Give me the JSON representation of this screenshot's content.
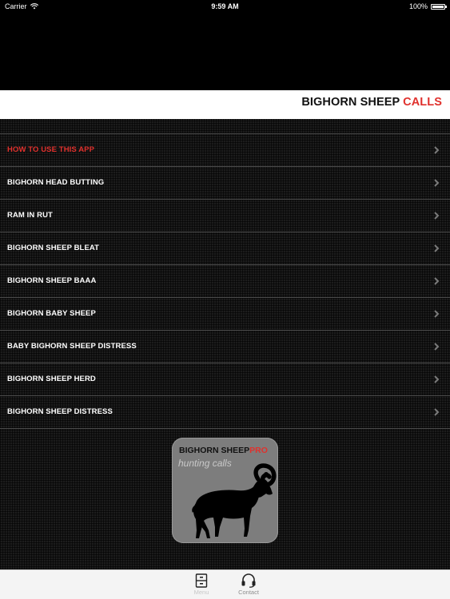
{
  "status_bar": {
    "carrier": "Carrier",
    "time": "9:59 AM",
    "battery": "100%",
    "battery_level": 1.0
  },
  "header": {
    "title_main": "BIGHORN SHEEP ",
    "title_accent": "CALLS",
    "accent_color": "#e0312d"
  },
  "menu": {
    "items": [
      {
        "label": "HOW TO USE THIS APP"
      },
      {
        "label": "BIGHORN HEAD BUTTING"
      },
      {
        "label": "RAM IN RUT"
      },
      {
        "label": "BIGHORN SHEEP BLEAT"
      },
      {
        "label": "BIGHORN SHEEP BAAA"
      },
      {
        "label": "BIGHORN BABY SHEEP"
      },
      {
        "label": "BABY BIGHORN SHEEP DISTRESS"
      },
      {
        "label": "BIGHORN SHEEP HERD"
      },
      {
        "label": "BIGHORN SHEEP DISTRESS"
      }
    ]
  },
  "promo": {
    "title": "BIGHORN SHEEP",
    "title_accent": "PRO",
    "subtitle": "hunting calls",
    "icon": "bighorn-ram-silhouette"
  },
  "tab_bar": {
    "tabs": [
      {
        "label": "Menu",
        "icon": "menu-drawer-icon"
      },
      {
        "label": "Contact",
        "icon": "headset-icon"
      }
    ]
  }
}
